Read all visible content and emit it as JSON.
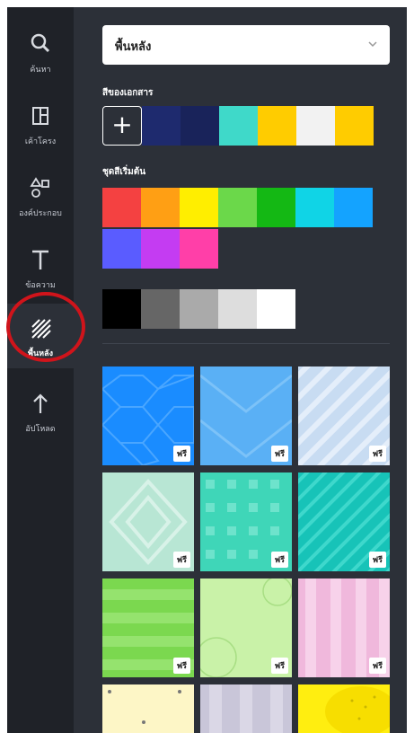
{
  "sidebar": {
    "items": [
      {
        "label": "ค้นหา",
        "icon": "search-icon"
      },
      {
        "label": "เค้าโครง",
        "icon": "layout-icon"
      },
      {
        "label": "องค์ประกอบ",
        "icon": "elements-icon"
      },
      {
        "label": "ข้อความ",
        "icon": "text-icon"
      },
      {
        "label": "พื้นหลัง",
        "icon": "background-icon",
        "active": true
      },
      {
        "label": "อัปโหลด",
        "icon": "upload-icon"
      }
    ]
  },
  "panel": {
    "dropdown_value": "พื้นหลัง",
    "document_colors_title": "สีของเอกสาร",
    "add_color_label": "+",
    "document_colors": [
      "#1e2a6e",
      "#19235a",
      "#3fd9c9",
      "#ffcc00",
      "#f2f2f2",
      "#ffcc00"
    ],
    "default_colors_title": "ชุดสีเริ่มต้น",
    "default_colors": [
      "#f44141",
      "#ff9f14",
      "#ffee00",
      "#6bd84a",
      "#14b814",
      "#10d4e6",
      "#14a3ff",
      "#5a5cff",
      "#c43cf2",
      "#ff3fa8"
    ],
    "gray_colors": [
      "#000000",
      "#666666",
      "#aaaaaa",
      "#dddddd",
      "#ffffff"
    ],
    "free_badge": "ฟรี"
  }
}
